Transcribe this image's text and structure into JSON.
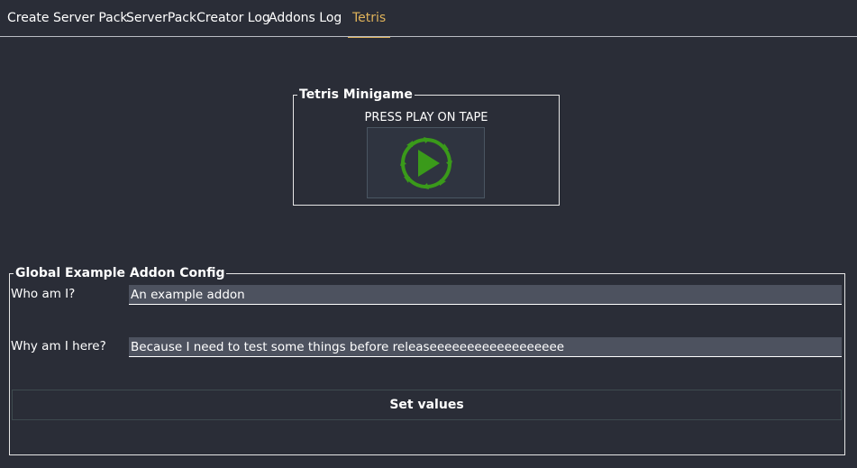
{
  "tabs": [
    {
      "label": "Create Server Pack",
      "active": false
    },
    {
      "label": "ServerPackCreator Log",
      "active": false
    },
    {
      "label": "Addons Log",
      "active": false
    },
    {
      "label": "Tetris",
      "active": true
    }
  ],
  "tetris": {
    "group_title": "Tetris Minigame",
    "prompt": "PRESS PLAY ON TAPE",
    "play_icon": "play-circle-icon",
    "icon_color": "#3a9a1a"
  },
  "addon_config": {
    "group_title": "Global Example Addon Config",
    "who_label": "Who am I?",
    "who_value": "An example addon",
    "why_label": "Why am I here?",
    "why_value": "Because I need to test some things before releaseeeeeeeeeeeeeeeeee",
    "set_button_label": "Set values"
  },
  "colors": {
    "background": "#2a2d37",
    "active_tab": "#e0b35a",
    "input_background": "#4d525f"
  }
}
